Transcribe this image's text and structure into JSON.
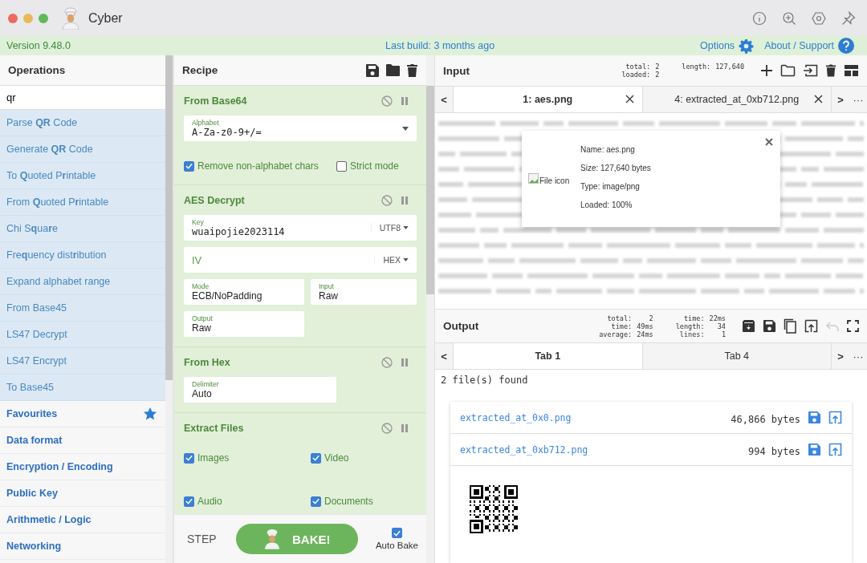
{
  "window": {
    "title": "Cyber"
  },
  "banner": {
    "version": "Version 9.48.0",
    "last_build": "Last build: 3 months ago",
    "options": "Options",
    "about": "About / Support"
  },
  "operations": {
    "title": "Operations",
    "search": "qr",
    "results": [
      "Parse **QR** Code",
      "Generate **QR** Code",
      "To **Q**uoted P**r**intable",
      "From **Q**uoted P**r**intable",
      "Chi S**q**ua**r**e",
      "Fre**q**uency dist**r**ibution",
      "Expand alphabet range",
      "From Base45",
      "LS47 Decrypt",
      "LS47 Encrypt",
      "To Base45"
    ],
    "categories": [
      {
        "label": "Favourites",
        "star": true
      },
      {
        "label": "Data format",
        "star": false
      },
      {
        "label": "Encryption / Encoding",
        "star": false
      },
      {
        "label": "Public Key",
        "star": false
      },
      {
        "label": "Arithmetic / Logic",
        "star": false
      },
      {
        "label": "Networking",
        "star": false
      }
    ]
  },
  "recipe": {
    "title": "Recipe",
    "ops": [
      {
        "name": "From Base64",
        "args": [
          {
            "kind": "select",
            "label": "Alphabet",
            "value": "A-Za-z0-9+/="
          },
          {
            "kind": "checkbox",
            "label": "Remove non-alphabet chars",
            "checked": true
          },
          {
            "kind": "checkbox",
            "label": "Strict mode",
            "checked": false
          }
        ]
      },
      {
        "name": "AES Decrypt",
        "args": [
          {
            "kind": "encoded",
            "label": "Key",
            "value": "wuaipojie2023114",
            "encoding": "UTF8"
          },
          {
            "kind": "encoded",
            "label": "IV",
            "encoding": "HEX"
          },
          {
            "kind": "field",
            "label": "Mode",
            "value": "ECB/NoPadding"
          },
          {
            "kind": "field",
            "label": "Input",
            "value": "Raw"
          },
          {
            "kind": "field",
            "label": "Output",
            "value": "Raw"
          }
        ]
      },
      {
        "name": "From Hex",
        "args": [
          {
            "kind": "field",
            "label": "Delimiter",
            "value": "Auto"
          }
        ]
      },
      {
        "name": "Extract Files",
        "args": [
          {
            "kind": "checkbox",
            "label": "Images",
            "checked": true
          },
          {
            "kind": "checkbox",
            "label": "Video",
            "checked": true
          },
          {
            "kind": "checkbox",
            "label": "Audio",
            "checked": true
          },
          {
            "kind": "checkbox",
            "label": "Documents",
            "checked": true
          }
        ]
      }
    ]
  },
  "bake": {
    "step": "STEP",
    "bake": "BAKE!",
    "auto_bake": {
      "label": "Auto Bake",
      "checked": true
    }
  },
  "input": {
    "title": "Input",
    "stat_groups": [
      [
        {
          "label": "total:",
          "value": "2"
        },
        {
          "label": "loaded:",
          "value": "2"
        }
      ],
      [
        {
          "label": "length:",
          "value": "127,640"
        }
      ]
    ],
    "nav": {
      "prev": "<",
      "next": ">",
      "more": "···"
    },
    "tabs": [
      {
        "label": "1: aes.png",
        "selected": true,
        "closable": true
      },
      {
        "label": "4: extracted_at_0xb712.png",
        "selected": false,
        "closable": true
      }
    ],
    "file_info": {
      "image_alt": "File icon",
      "lines": [
        "Name: aes.png",
        "Size: 127,640 bytes",
        "Type: image/png",
        "Loaded: 100%"
      ]
    }
  },
  "output": {
    "title": "Output",
    "stat_groups": [
      [
        {
          "label": "total:",
          "value": "2"
        },
        {
          "label": "time:",
          "value": "49ms"
        },
        {
          "label": "average:",
          "value": "24ms"
        }
      ],
      [
        {
          "label": "time:",
          "value": "22ms"
        },
        {
          "label": "length:",
          "value": "34"
        },
        {
          "label": "lines:",
          "value": "1"
        }
      ]
    ],
    "nav": {
      "prev": "<",
      "next": ">",
      "more": "···"
    },
    "tabs": [
      {
        "label": "Tab 1",
        "selected": true,
        "closable": false
      },
      {
        "label": "Tab 4",
        "selected": false,
        "closable": false
      }
    ],
    "summary": "2 file(s) found",
    "files": [
      {
        "name": "extracted_at_0x0.png",
        "size": "46,866 bytes"
      },
      {
        "name": "extracted_at_0xb712.png",
        "size": "994 bytes"
      }
    ]
  }
}
